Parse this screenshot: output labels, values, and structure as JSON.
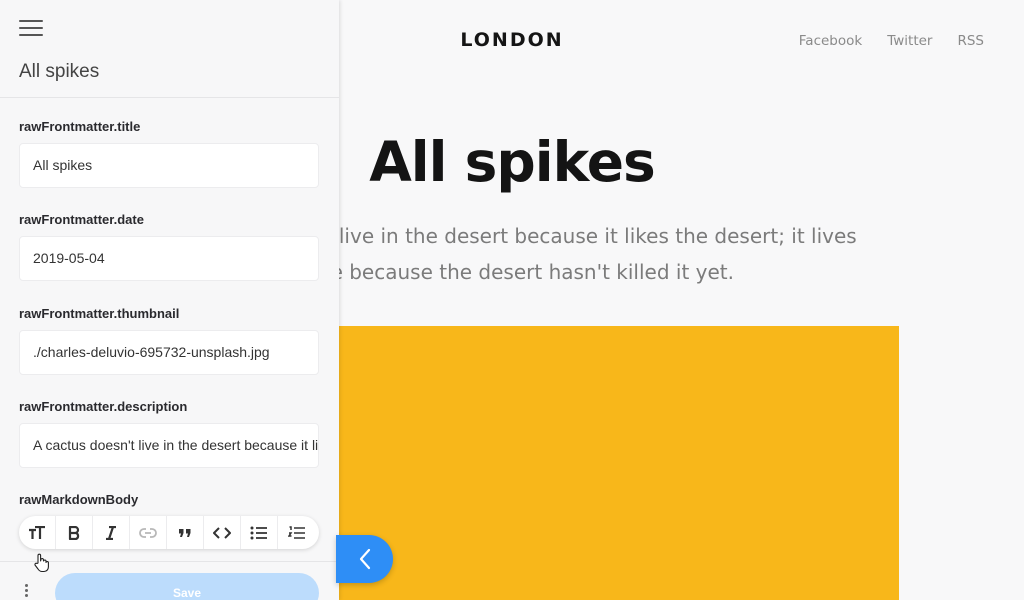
{
  "site": {
    "logo": "LONDON",
    "nav": [
      "Facebook",
      "Twitter",
      "RSS"
    ],
    "hero_title": "All spikes",
    "hero_description": "A cactus doesn't live in the desert because it likes the desert; it lives there because the desert hasn't killed it yet.",
    "image_color": "#f8b71a"
  },
  "sidebar": {
    "title": "All spikes",
    "fields": [
      {
        "label": "rawFrontmatter.title",
        "value": "All spikes"
      },
      {
        "label": "rawFrontmatter.date",
        "value": "2019-05-04"
      },
      {
        "label": "rawFrontmatter.thumbnail",
        "value": "./charles-deluvio-695732-unsplash.jpg"
      },
      {
        "label": "rawFrontmatter.description",
        "value": "A cactus doesn't live in the desert because it likes the desert; it lives there because the desert hasn't killed it yet."
      }
    ],
    "markdown_label": "rawMarkdownBody",
    "toolbar": [
      "text-size-icon",
      "bold-icon",
      "italic-icon",
      "link-icon",
      "quote-icon",
      "code-icon",
      "bullet-list-icon",
      "numbered-list-icon"
    ],
    "save_label": "Save"
  },
  "colors": {
    "accent": "#2e8ef6",
    "save_disabled": "#bcdcfc"
  }
}
